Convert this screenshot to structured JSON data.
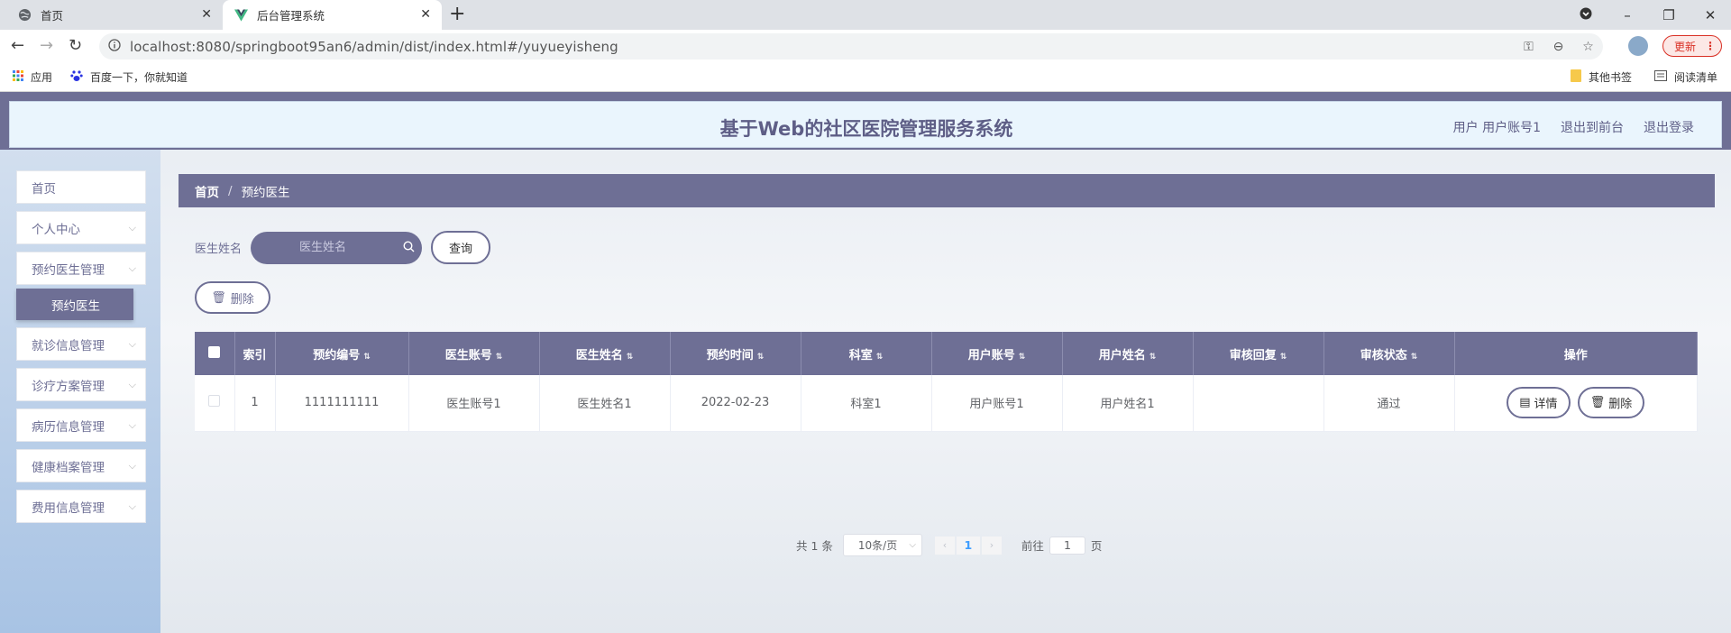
{
  "browser": {
    "tabs": [
      {
        "title": "首页",
        "icon": "globe-icon"
      },
      {
        "title": "后台管理系统",
        "icon": "vue-icon"
      }
    ],
    "url": "localhost:8080/springboot95an6/admin/dist/index.html#/yuyueyisheng",
    "update_label": "更新",
    "bookmarks": [
      {
        "label": "应用",
        "icon": "apps-grid-icon"
      },
      {
        "label": "百度一下，你就知道",
        "icon": "baidu-paw-icon"
      }
    ],
    "bookmarks_right": [
      {
        "label": "其他书签",
        "icon": "folder-icon"
      },
      {
        "label": "阅读清单",
        "icon": "reading-list-icon"
      }
    ]
  },
  "header": {
    "title": "基于Web的社区医院管理服务系统",
    "user": "用户 用户账号1",
    "back_front": "退出到前台",
    "logout": "退出登录"
  },
  "sidebar": {
    "items": [
      {
        "label": "首页",
        "expandable": false
      },
      {
        "label": "个人中心",
        "expandable": true
      },
      {
        "label": "预约医生管理",
        "expandable": true
      },
      {
        "label": "就诊信息管理",
        "expandable": true
      },
      {
        "label": "诊疗方案管理",
        "expandable": true
      },
      {
        "label": "病历信息管理",
        "expandable": true
      },
      {
        "label": "健康档案管理",
        "expandable": true
      },
      {
        "label": "费用信息管理",
        "expandable": true
      }
    ],
    "active_sub": "预约医生"
  },
  "breadcrumb": {
    "home": "首页",
    "sep": "/",
    "current": "预约医生"
  },
  "search": {
    "label": "医生姓名",
    "placeholder": "医生姓名",
    "button": "查询"
  },
  "toolbar": {
    "delete_label": "删除"
  },
  "table": {
    "columns": [
      "索引",
      "预约编号",
      "医生账号",
      "医生姓名",
      "预约时间",
      "科室",
      "用户账号",
      "用户姓名",
      "审核回复",
      "审核状态",
      "操作"
    ],
    "rows": [
      {
        "index": "1",
        "booking_no": "1111111111",
        "doctor_account": "医生账号1",
        "doctor_name": "医生姓名1",
        "time": "2022-02-23",
        "department": "科室1",
        "user_account": "用户账号1",
        "user_name": "用户姓名1",
        "reply": "",
        "status": "通过"
      }
    ],
    "actions": {
      "detail": "详情",
      "delete": "删除"
    }
  },
  "pagination": {
    "total": "共 1 条",
    "page_size": "10条/页",
    "current": "1",
    "goto_prefix": "前往",
    "goto_value": "1",
    "goto_suffix": "页"
  },
  "colors": {
    "theme": "#6e6f95",
    "header_bg": "#eaf5fd"
  }
}
